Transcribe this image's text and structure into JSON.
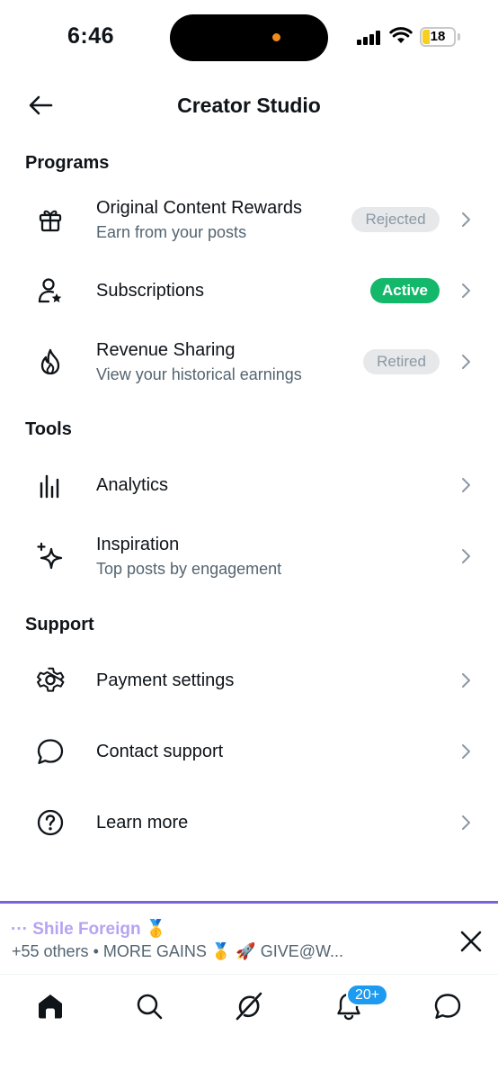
{
  "status": {
    "time": "6:46",
    "battery": "18"
  },
  "header": {
    "title": "Creator Studio",
    "back_icon": "arrow-left-icon"
  },
  "sections": {
    "programs": {
      "title": "Programs",
      "items": [
        {
          "icon": "gift-icon",
          "title": "Original Content Rewards",
          "subtitle": "Earn from your posts",
          "badge": "Rejected"
        },
        {
          "icon": "person-star-icon",
          "title": "Subscriptions",
          "badge": "Active"
        },
        {
          "icon": "flame-icon",
          "title": "Revenue Sharing",
          "subtitle": "View your historical earnings",
          "badge": "Retired"
        }
      ]
    },
    "tools": {
      "title": "Tools",
      "items": [
        {
          "icon": "bar-chart-icon",
          "title": "Analytics"
        },
        {
          "icon": "sparkle-icon",
          "title": "Inspiration",
          "subtitle": "Top posts by engagement"
        }
      ]
    },
    "support": {
      "title": "Support",
      "items": [
        {
          "icon": "gear-icon",
          "title": "Payment settings"
        },
        {
          "icon": "chat-bubble-icon",
          "title": "Contact support"
        },
        {
          "icon": "question-circle-icon",
          "title": "Learn more"
        }
      ]
    }
  },
  "banner": {
    "line1": "··· Shile Foreign 🥇",
    "line2": "+55 others • MORE GAINS 🥇 🚀 GIVE@W..."
  },
  "tabbar": {
    "items": [
      "home-icon",
      "search-icon",
      "grok-icon",
      "bell-icon",
      "messages-icon"
    ],
    "notification_count": "20+"
  },
  "colors": {
    "accent_blue": "#1d9bf0",
    "active_green": "#14b86a",
    "banner_purple": "#7b63d9"
  }
}
